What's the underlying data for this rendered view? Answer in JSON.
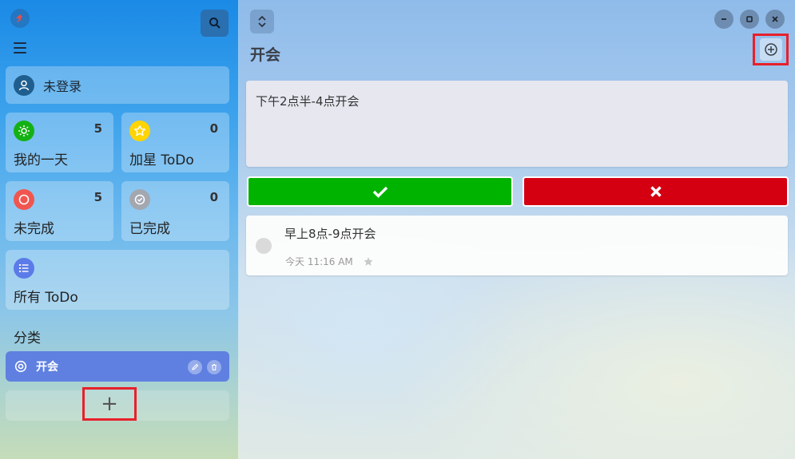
{
  "sidebar": {
    "user": {
      "label": "未登录"
    },
    "tiles": [
      {
        "name": "我的一天",
        "count": "5",
        "icon": "sun-icon",
        "color": "#14b114"
      },
      {
        "name": "加星 ToDo",
        "count": "0",
        "icon": "star-icon",
        "color": "#ffd400"
      },
      {
        "name": "未完成",
        "count": "5",
        "icon": "circle-icon",
        "color": "#f0564f"
      },
      {
        "name": "已完成",
        "count": "0",
        "icon": "check-circle-icon",
        "color": "#a3a7b0"
      }
    ],
    "all_todo": {
      "name": "所有 ToDo",
      "icon": "list-icon",
      "color": "#5b7be8"
    },
    "section_label": "分类",
    "categories": [
      {
        "label": "开会",
        "color": "#5f80e0"
      }
    ],
    "add_category_label": "+"
  },
  "main": {
    "title": "开会",
    "editor_text": "下午2点半-4点开会",
    "todos": [
      {
        "title": "早上8点-9点开会",
        "time": "今天 11:16 AM",
        "starred": false
      }
    ]
  },
  "colors": {
    "confirm": "#00b300",
    "cancel": "#d40012",
    "highlight": "#e8202a"
  }
}
